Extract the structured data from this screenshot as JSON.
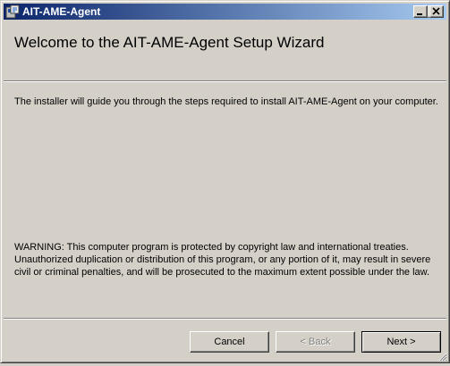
{
  "window": {
    "title": "AIT-AME-Agent",
    "icon": "installer-icon",
    "controls": [
      "minimize-icon",
      "maximize-icon",
      "close-icon"
    ]
  },
  "header": {
    "title": "Welcome to the AIT-AME-Agent Setup Wizard"
  },
  "body": {
    "intro": "The installer will guide you through the steps required to install AIT-AME-Agent on your computer.",
    "warning": "WARNING: This computer program is protected by copyright law and international treaties. Unauthorized duplication or distribution of this program, or any portion of it, may result in severe civil or criminal penalties, and will be prosecuted to the maximum extent possible under the law."
  },
  "buttons": {
    "cancel": "Cancel",
    "back": "< Back",
    "next": "Next >",
    "back_enabled": false
  },
  "colors": {
    "face": "#d4d0c8",
    "title_start": "#0a246a",
    "title_end": "#a6caf0",
    "disabled_text": "#808080"
  }
}
